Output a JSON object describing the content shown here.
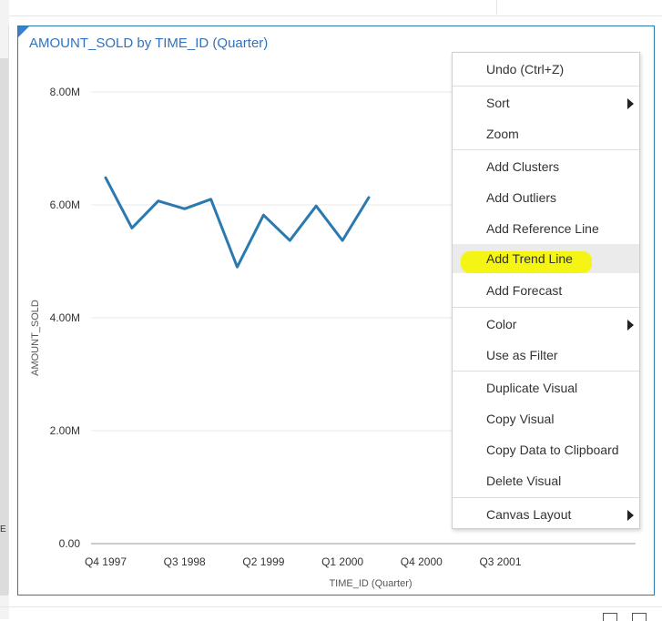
{
  "visual": {
    "title": "AMOUNT_SOLD by TIME_ID (Quarter)"
  },
  "edge_text": "E",
  "chart_data": {
    "type": "line",
    "title": "AMOUNT_SOLD by TIME_ID (Quarter)",
    "xlabel": "TIME_ID (Quarter)",
    "ylabel": "AMOUNT_SOLD",
    "ylim": [
      0,
      8000000
    ],
    "y_ticks": [
      {
        "value": 0,
        "label": "0.00"
      },
      {
        "value": 2000000,
        "label": "2.00M"
      },
      {
        "value": 4000000,
        "label": "4.00M"
      },
      {
        "value": 6000000,
        "label": "6.00M"
      },
      {
        "value": 8000000,
        "label": "8.00M"
      }
    ],
    "x_tick_labels": [
      {
        "index": 0,
        "label": "Q4 1997"
      },
      {
        "index": 3,
        "label": "Q3 1998"
      },
      {
        "index": 6,
        "label": "Q2 1999"
      },
      {
        "index": 9,
        "label": "Q1 2000"
      },
      {
        "index": 12,
        "label": "Q4 2000"
      },
      {
        "index": 15,
        "label": "Q3 2001"
      }
    ],
    "x_count": 17,
    "grid": true,
    "series": [
      {
        "color": "#2a7ab0",
        "values": [
          6480000,
          5590000,
          6070000,
          5930000,
          6100000,
          4900000,
          5820000,
          5370000,
          5980000,
          5370000,
          6130000
        ]
      }
    ]
  },
  "context_menu": {
    "items": [
      {
        "label": "Undo (Ctrl+Z)",
        "submenu": false
      },
      {
        "label": "Sort",
        "submenu": true
      },
      {
        "label": "Zoom",
        "submenu": false
      },
      {
        "label": "Add Clusters",
        "submenu": false
      },
      {
        "label": "Add Outliers",
        "submenu": false
      },
      {
        "label": "Add Reference Line",
        "submenu": false
      },
      {
        "label": "Add Trend Line",
        "submenu": false,
        "highlighted": true
      },
      {
        "label": "Add Forecast",
        "submenu": false
      },
      {
        "label": "Color",
        "submenu": true
      },
      {
        "label": "Use as Filter",
        "submenu": false
      },
      {
        "label": "Duplicate Visual",
        "submenu": false
      },
      {
        "label": "Copy Visual",
        "submenu": false
      },
      {
        "label": "Copy Data to Clipboard",
        "submenu": false
      },
      {
        "label": "Delete Visual",
        "submenu": false
      },
      {
        "label": "Canvas Layout",
        "submenu": true
      }
    ]
  }
}
